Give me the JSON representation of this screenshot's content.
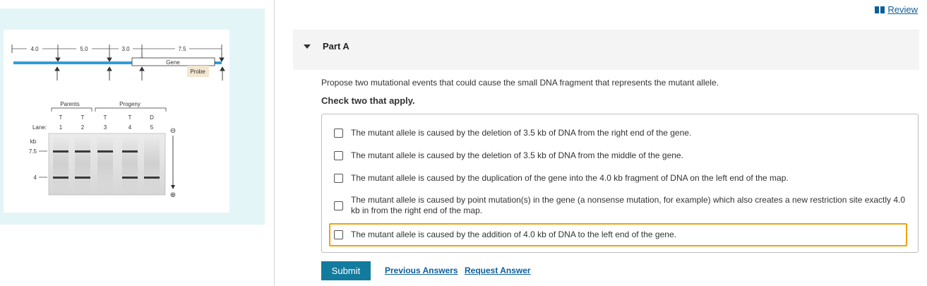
{
  "header": {
    "review_label": "Review"
  },
  "figure": {
    "map": {
      "segment_labels": [
        "4.0",
        "5.0",
        "3.0",
        "7.5"
      ],
      "gene_label": "Gene",
      "probe_label": "Probe"
    },
    "gel": {
      "group_labels": [
        "Parents",
        "Progeny"
      ],
      "genotypes": [
        "T",
        "T",
        "T",
        "T",
        "D"
      ],
      "lane_prefix": "Lane:",
      "lane_numbers": [
        "1",
        "2",
        "3",
        "4",
        "5"
      ],
      "axis_unit": "kb",
      "size_markers": [
        "7.5",
        "4"
      ],
      "electrode_negative": "⊖",
      "electrode_positive": "⊕"
    }
  },
  "part": {
    "title": "Part A"
  },
  "question": {
    "prompt": "Propose two mutational events that could cause the small DNA fragment that represents the mutant allele.",
    "instruction": "Check two that apply.",
    "options": [
      {
        "label": "The mutant allele is caused by the deletion of 3.5 kb of DNA from the right end of the gene.",
        "checked": false
      },
      {
        "label": "The mutant allele is caused by the deletion of 3.5 kb of DNA from the middle of the gene.",
        "checked": false
      },
      {
        "label": "The mutant allele is caused by the duplication of the gene into the 4.0 kb fragment of DNA on the left end of the map.",
        "checked": false
      },
      {
        "label": "The mutant allele is caused by point mutation(s) in the gene (a nonsense mutation, for example) which also creates a new restriction site exactly 4.0 kb in from the right end of the map.",
        "checked": false
      },
      {
        "label": "The mutant allele is caused by the addition of 4.0 kb of DNA to the left end of the gene.",
        "checked": false
      }
    ]
  },
  "actions": {
    "submit_label": "Submit",
    "previous_answers_label": "Previous Answers",
    "request_answer_label": "Request Answer"
  },
  "colors": {
    "accent": "#137b9d",
    "link": "#0d5f9b",
    "focus": "#f0a30a",
    "dna_strand": "#2e9fd8",
    "figure_panel_bg": "#e3f5f7"
  }
}
